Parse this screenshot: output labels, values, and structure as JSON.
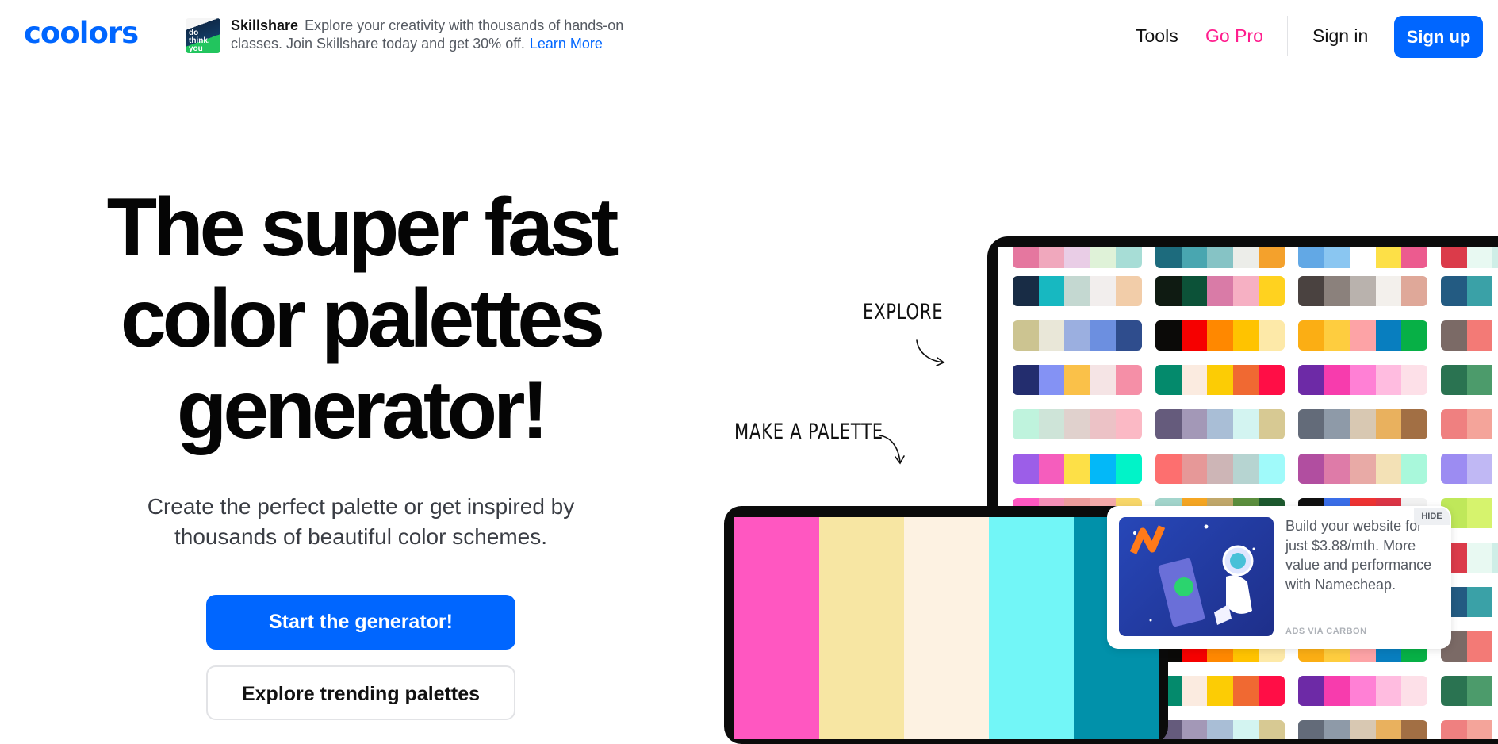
{
  "header": {
    "logo": "coolors",
    "ad": {
      "brand": "Skillshare",
      "text": "Explore your creativity with thousands of hands-on classes. Join Skillshare today and get 30% off.",
      "link": "Learn More",
      "thumb_text": "do think, you can. try"
    },
    "nav": {
      "tools": "Tools",
      "go_pro": "Go Pro",
      "sign_in": "Sign in",
      "sign_up": "Sign up"
    }
  },
  "hero": {
    "title": "The super fast color palettes generator!",
    "subtitle": "Create the perfect palette or get inspired by thousands of beautiful color schemes.",
    "primary_button": "Start the generator!",
    "secondary_button": "Explore trending palettes"
  },
  "illustration": {
    "explore_label": "EXPLORE",
    "make_label": "MAKE A PALETTE",
    "generator_colors": [
      "#ff57c1",
      "#f7e6a3",
      "#fdf2e2",
      "#72f6f7",
      "#0191aa"
    ],
    "palettes": [
      [
        "#e5779f",
        "#f0a8bd",
        "#e9cde6",
        "#dff2d8",
        "#a7ddd6"
      ],
      [
        "#1d6b7d",
        "#49a6b0",
        "#86c3c5",
        "#ecede9",
        "#f4a12c"
      ],
      [
        "#62a8e5",
        "#8ac6f1",
        "#ffffff",
        "#fde047",
        "#ec5b8f"
      ],
      [
        "#db3b4a",
        "#e8f9f2",
        "#cfeee7",
        "#bde5e5",
        "#ffffff"
      ],
      [
        "#182c45",
        "#17b8c1",
        "#c4d8d1",
        "#f2eeed",
        "#f2cda9"
      ],
      [
        "#0f1b12",
        "#0c5238",
        "#d97ba7",
        "#f6b0c3",
        "#ffd21f"
      ],
      [
        "#4a4240",
        "#8b817c",
        "#b9b2ad",
        "#f3f0ec",
        "#dfa899"
      ],
      [
        "#235b82",
        "#3aa1a7",
        "#ffffff",
        "#ffffff",
        "#ffffff"
      ],
      [
        "#ccc491",
        "#e9e7d8",
        "#9bafe0",
        "#6c8fe0",
        "#2f4d8d"
      ],
      [
        "#0b0a08",
        "#f60000",
        "#ff8800",
        "#ffc300",
        "#fde9a8"
      ],
      [
        "#fbae14",
        "#fecd3f",
        "#fda3a6",
        "#087ebf",
        "#07b046"
      ],
      [
        "#7b6a66",
        "#f37a76",
        "#ffffff",
        "#ffffff",
        "#ffffff"
      ],
      [
        "#232d6e",
        "#8492f4",
        "#fac149",
        "#f5e4e5",
        "#f58fa7"
      ],
      [
        "#048a6c",
        "#fbebe0",
        "#fccc05",
        "#f06932",
        "#ff0e46"
      ],
      [
        "#6d2aa6",
        "#f73cad",
        "#ff80d5",
        "#ffbce0",
        "#fde0e8"
      ],
      [
        "#2a7351",
        "#4c9b6b",
        "#ffffff",
        "#ffffff",
        "#ffffff"
      ],
      [
        "#bff3dd",
        "#cee4d8",
        "#e0d1cd",
        "#ecc2c6",
        "#fbb9c5"
      ],
      [
        "#655b7c",
        "#a398b7",
        "#a9bed6",
        "#d3f4f1",
        "#d7c993"
      ],
      [
        "#636b79",
        "#8e9aa8",
        "#d8c8b2",
        "#e9b15e",
        "#a26f44"
      ],
      [
        "#ef8080",
        "#f4a49a",
        "#ffffff",
        "#ffffff",
        "#ffffff"
      ],
      [
        "#9c5ee8",
        "#f55dbd",
        "#fde047",
        "#03b8f8",
        "#01f3c8"
      ],
      [
        "#fd6f6f",
        "#e69898",
        "#cdb5b6",
        "#b6d4d1",
        "#a0fafa"
      ],
      [
        "#b14ea0",
        "#de7ba8",
        "#e8aaa6",
        "#f3e1b6",
        "#a9f8db"
      ],
      [
        "#9c8cf2",
        "#c0b8f4",
        "#ffffff",
        "#ffffff",
        "#ffffff"
      ],
      [
        "#ff57c1",
        "#f58fb7",
        "#ec9c9c",
        "#f4a9a8",
        "#f8d76a"
      ],
      [
        "#a3d5cc",
        "#f5a623",
        "#c1a86b",
        "#5c8f3e",
        "#1d5a2f"
      ],
      [
        "#101010",
        "#3a6ee8",
        "#ee3333",
        "#dc3545",
        "#f2f2f2"
      ],
      [
        "#bfe85a",
        "#d6f36d",
        "#ffffff",
        "#ffffff",
        "#ffffff"
      ]
    ]
  },
  "carbon_ad": {
    "text": "Build your website for just $3.88/mth. More value and performance with Namecheap.",
    "via": "ADS VIA CARBON",
    "hide": "HIDE"
  }
}
